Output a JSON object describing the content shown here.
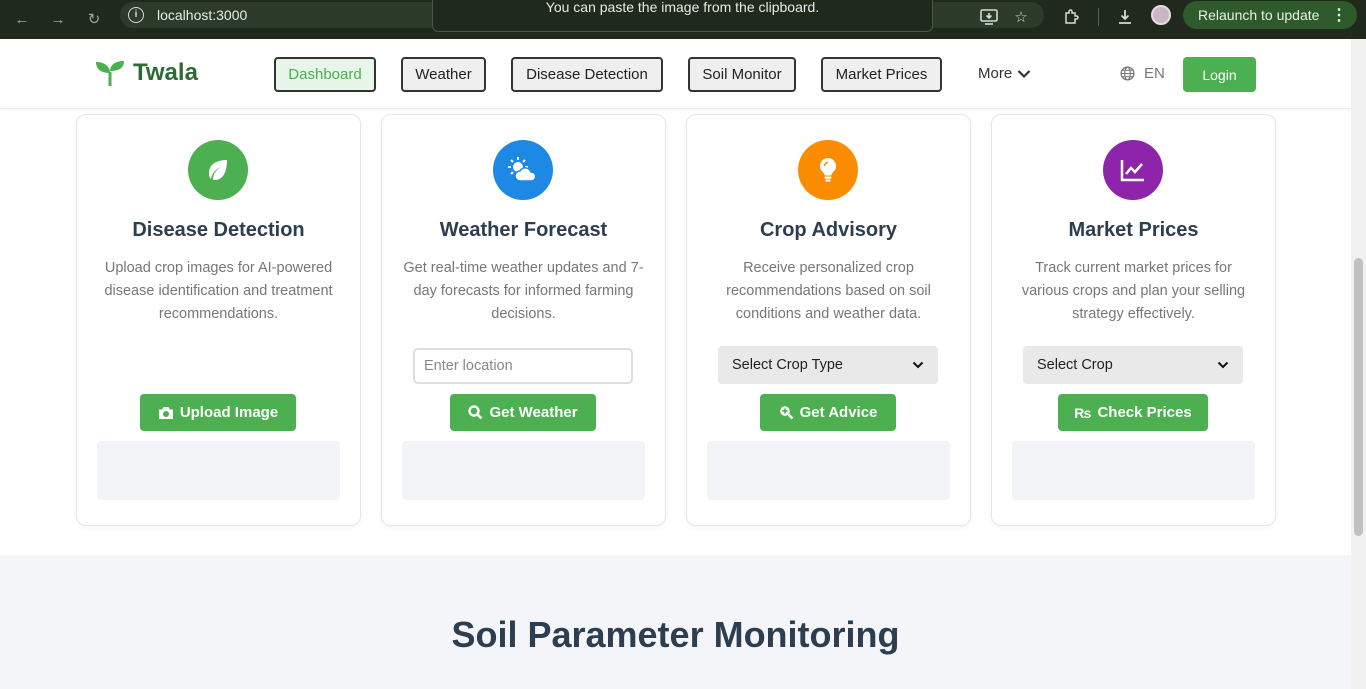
{
  "browser": {
    "url": "localhost:3000",
    "toast": "You can paste the image from the clipboard.",
    "relaunch_label": "Relaunch to update"
  },
  "header": {
    "brand": "Twala",
    "nav": [
      {
        "label": "Dashboard",
        "active": true
      },
      {
        "label": "Weather"
      },
      {
        "label": "Disease Detection"
      },
      {
        "label": "Soil Monitor"
      },
      {
        "label": "Market Prices"
      }
    ],
    "more_label": "More",
    "language": "EN",
    "login_label": "Login"
  },
  "cards": [
    {
      "title": "Disease Detection",
      "description": "Upload crop images for AI-powered disease identification and treatment recommendations.",
      "button": "Upload Image",
      "icon": "leaf-icon",
      "color": "#4caf50"
    },
    {
      "title": "Weather Forecast",
      "description": "Get real-time weather updates and 7-day forecasts for informed farming decisions.",
      "input_placeholder": "Enter location",
      "button": "Get Weather",
      "icon": "sun-cloud-icon",
      "color": "#1e88e5"
    },
    {
      "title": "Crop Advisory",
      "description": "Receive personalized crop recommendations based on soil conditions and weather data.",
      "select_value": "Select Crop Type",
      "button": "Get Advice",
      "icon": "lightbulb-icon",
      "color": "#fb8c00"
    },
    {
      "title": "Market Prices",
      "description": "Track current market prices for various crops and plan your selling strategy effectively.",
      "select_value": "Select Crop",
      "button": "Check Prices",
      "icon": "chart-line-icon",
      "color": "#8e24aa"
    }
  ],
  "soil": {
    "title": "Soil Parameter Monitoring"
  },
  "colors": {
    "primary": "#4caf50",
    "heading": "#2c3e50",
    "brand": "#2e6b32"
  }
}
